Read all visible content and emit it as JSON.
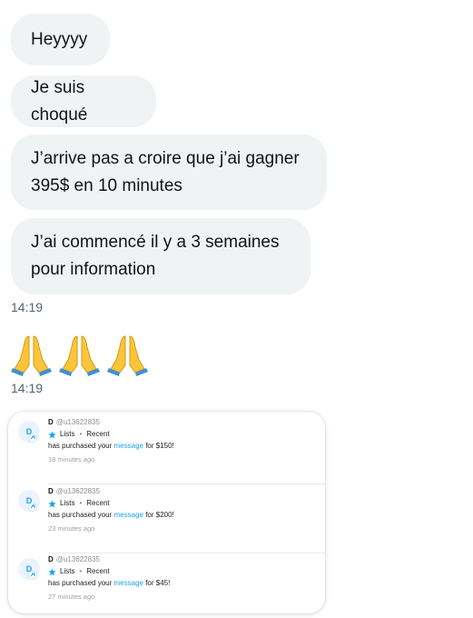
{
  "messages": [
    {
      "text": "Heyyyy"
    },
    {
      "text": "Je suis choqué"
    },
    {
      "text": "J’arrive pas a croire que j’ai gagner 395$ en 10 minutes"
    },
    {
      "text": "J’ai commencé il y a 3 semaines pour information"
    }
  ],
  "timestamps": [
    "14:19",
    "14:19"
  ],
  "emoji": {
    "icon": "folded-hands",
    "count": 3
  },
  "screenshot_card": {
    "notifications": [
      {
        "avatar_initial": "D",
        "name": "D",
        "handle": "@u13622835",
        "list_label": "Lists",
        "separator": "•",
        "recent_label": "Recent",
        "text_before": "has purchased your",
        "link_text": "message",
        "text_after": "for $150!",
        "time": "18 minutes ago"
      },
      {
        "avatar_initial": "D",
        "name": "D",
        "handle": "@u13622835",
        "list_label": "Lists",
        "separator": "•",
        "recent_label": "Recent",
        "text_before": "has purchased your",
        "link_text": "message",
        "text_after": "for $200!",
        "time": "23 minutes ago"
      },
      {
        "avatar_initial": "D",
        "name": "D",
        "handle": "@u13622835",
        "list_label": "Lists",
        "separator": "•",
        "recent_label": "Recent",
        "text_before": "has purchased your",
        "link_text": "message",
        "text_after": "for $45!",
        "time": "27 minutes ago"
      }
    ]
  },
  "colors": {
    "bubble_bg": "#eff3f4",
    "link": "#1da1f2",
    "timestamp": "#536471"
  }
}
